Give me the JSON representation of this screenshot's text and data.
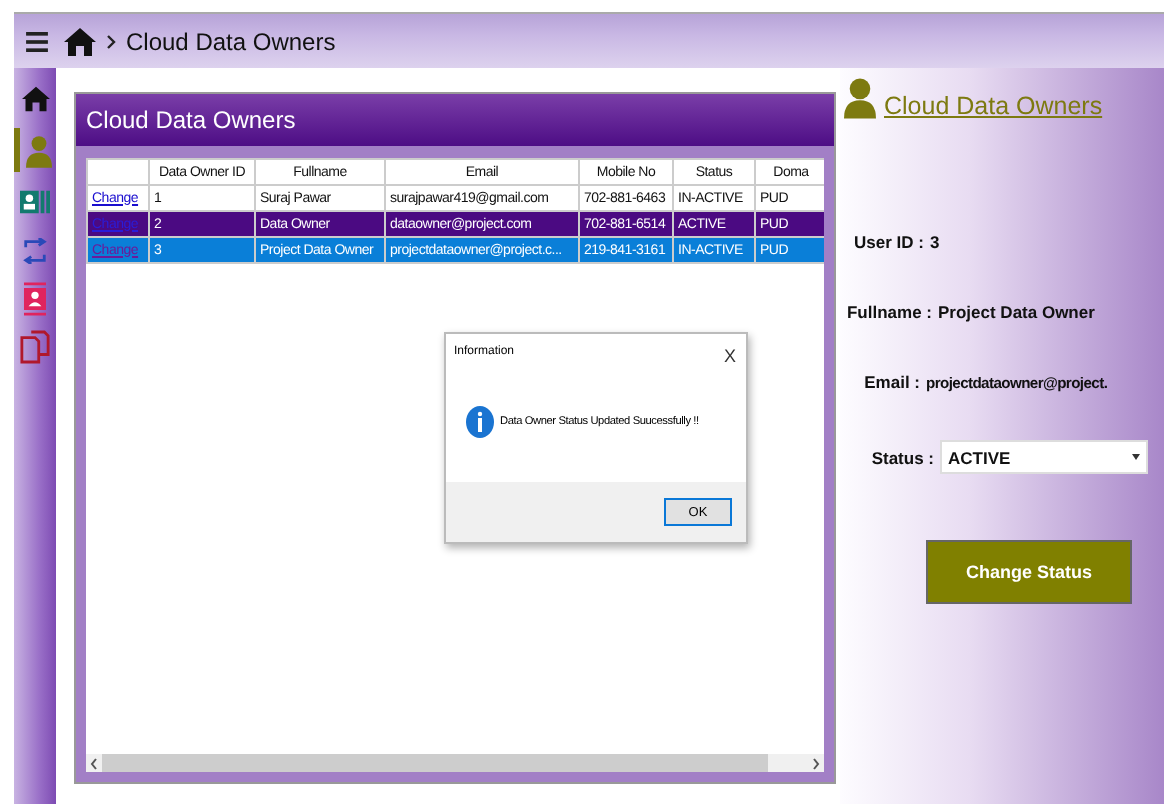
{
  "header": {
    "breadcrumb": "Cloud Data Owners"
  },
  "sidebar": {
    "items": [
      {
        "kind": "home",
        "selected": false
      },
      {
        "kind": "person",
        "selected": true
      },
      {
        "kind": "card",
        "selected": false
      },
      {
        "kind": "swap",
        "selected": false
      },
      {
        "kind": "badge",
        "selected": false
      },
      {
        "kind": "pages",
        "selected": false
      }
    ]
  },
  "grid_panel": {
    "title": "Cloud Data Owners",
    "columns": [
      "Data Owner ID",
      "Fullname",
      "Email",
      "Mobile No",
      "Status",
      "Doma"
    ],
    "rows": [
      {
        "action": "Change",
        "cells": [
          "1",
          "Suraj Pawar",
          "surajpawar419@gmail.com",
          "702-881-6463",
          "IN-ACTIVE",
          "PUD"
        ],
        "accent": false,
        "selected": false
      },
      {
        "action": "Change",
        "cells": [
          "2",
          "Data Owner",
          "dataowner@project.com",
          "702-881-6514",
          "ACTIVE",
          "PUD"
        ],
        "accent": true,
        "selected": false
      },
      {
        "action": "Change",
        "cells": [
          "3",
          "Project Data Owner",
          "projectdataowner@project.c...",
          "219-841-3161",
          "IN-ACTIVE",
          "PUD"
        ],
        "accent": false,
        "selected": true
      }
    ]
  },
  "details": {
    "title": "Cloud Data Owners",
    "user_id_label": "User ID :",
    "user_id": "3",
    "fullname_label": "Fullname :",
    "fullname": "Project Data Owner",
    "email_label": "Email :",
    "email": "projectdataowner@project.",
    "status_label": "Status :",
    "status": "ACTIVE",
    "button": "Change Status"
  },
  "dialog": {
    "title": "Information",
    "close": "X",
    "message": "Data Owner Status Updated Suucessfully !!",
    "button": "OK"
  }
}
